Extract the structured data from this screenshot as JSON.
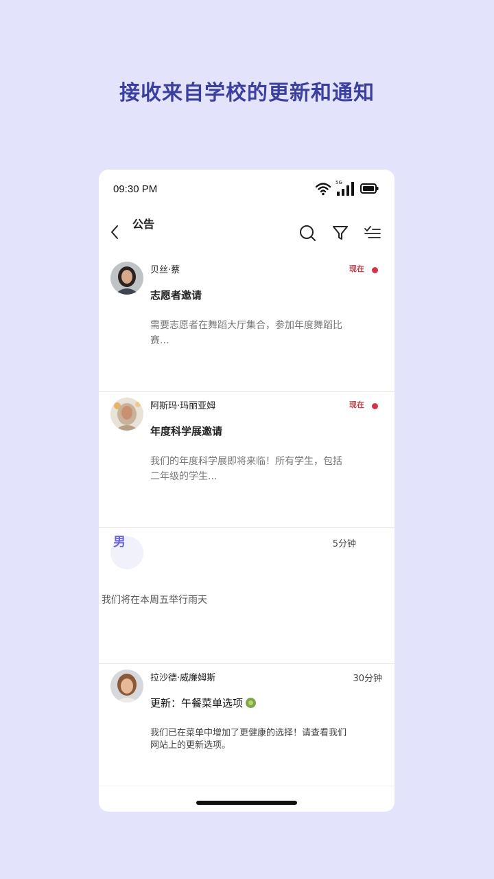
{
  "headline": "接收来自学校的更新和通知",
  "status_bar": {
    "time": "09:30 PM",
    "network_label": "5G",
    "icons": [
      "wifi-icon",
      "cellular-signal-icon",
      "battery-icon"
    ]
  },
  "header": {
    "title": "公告",
    "icons": [
      "back-arrow-icon",
      "search-icon",
      "filter-icon",
      "mark-read-icon"
    ]
  },
  "announcements": [
    {
      "sender": "贝丝·蔡",
      "time": "现在",
      "unread": true,
      "subject": "志愿者邀请",
      "preview": "需要志愿者在舞蹈大厅集合，参加年度舞蹈比赛..."
    },
    {
      "sender": "阿斯玛·玛丽亚姆",
      "time": "现在",
      "unread": true,
      "subject": "年度科学展邀请",
      "preview": "我们的年度科学展即将来临！所有学生，包括二年级的学生..."
    },
    {
      "sender": "男",
      "time": "5分钟",
      "unread": false,
      "subject": "",
      "preview": "，我们将在本周五举行雨天"
    },
    {
      "sender": "拉沙德·威廉姆斯",
      "time": "30分钟",
      "unread": false,
      "subject": "更新：午餐菜单选项",
      "preview": "我们已在菜单中增加了更健康的选择！请查看我们网站上的更新选项。"
    }
  ],
  "colors": {
    "background": "#e3e3fb",
    "headline": "#3b3f9e",
    "accent_time": "#c0404a",
    "unread_dot": "#d6334a"
  }
}
